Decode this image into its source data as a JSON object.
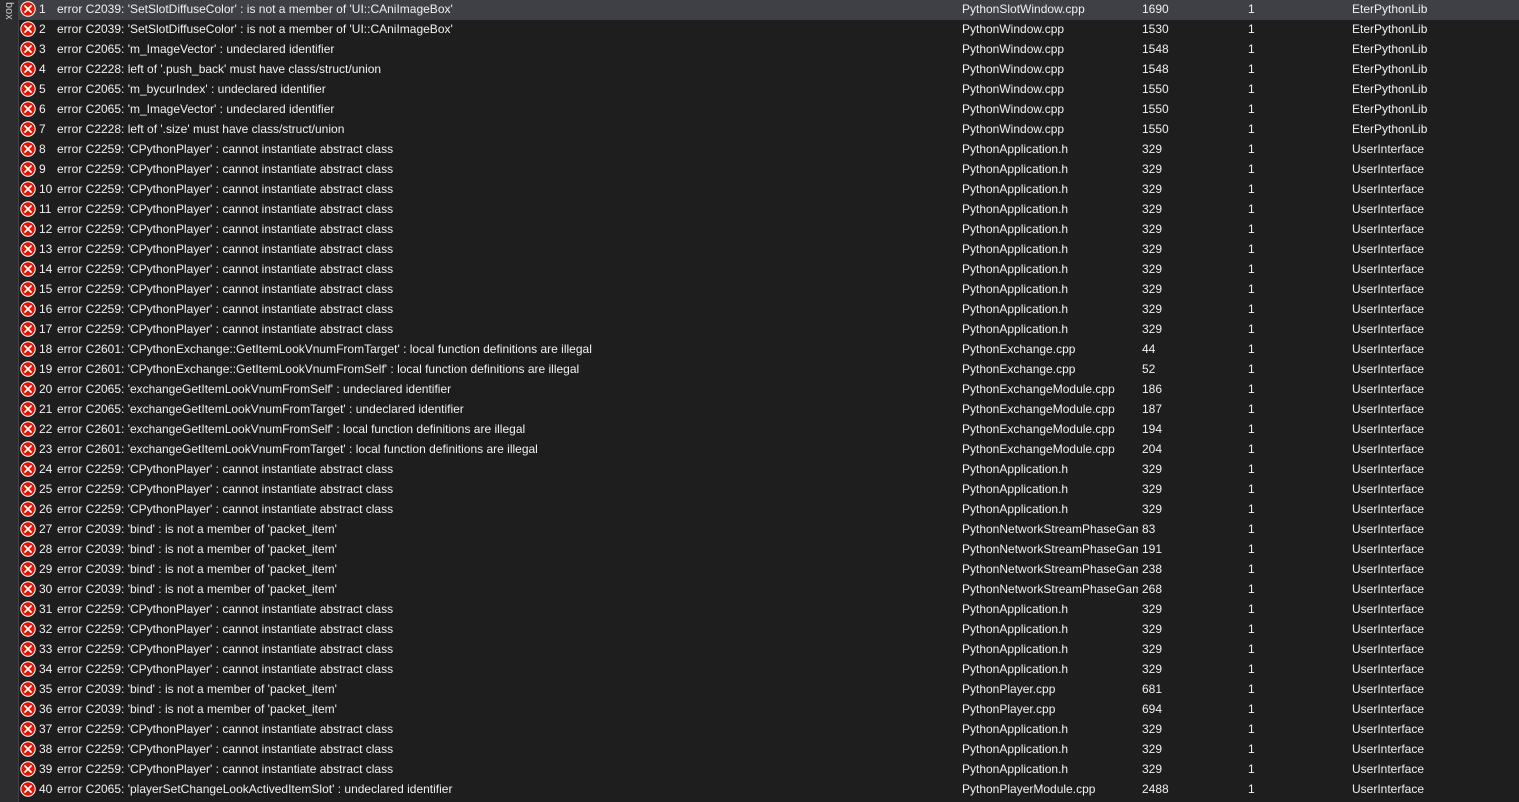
{
  "panel": {
    "side_label": "box"
  },
  "errors": [
    {
      "num": "1",
      "desc": "error C2039: 'SetSlotDiffuseColor' : is not a member of 'UI::CAniImageBox'",
      "file": "PythonSlotWindow.cpp",
      "line": "1690",
      "col": "1",
      "project": "EterPythonLib"
    },
    {
      "num": "2",
      "desc": "error C2039: 'SetSlotDiffuseColor' : is not a member of 'UI::CAniImageBox'",
      "file": "PythonWindow.cpp",
      "line": "1530",
      "col": "1",
      "project": "EterPythonLib"
    },
    {
      "num": "3",
      "desc": "error C2065: 'm_ImageVector' : undeclared identifier",
      "file": "PythonWindow.cpp",
      "line": "1548",
      "col": "1",
      "project": "EterPythonLib"
    },
    {
      "num": "4",
      "desc": "error C2228: left of '.push_back' must have class/struct/union",
      "file": "PythonWindow.cpp",
      "line": "1548",
      "col": "1",
      "project": "EterPythonLib"
    },
    {
      "num": "5",
      "desc": "error C2065: 'm_bycurIndex' : undeclared identifier",
      "file": "PythonWindow.cpp",
      "line": "1550",
      "col": "1",
      "project": "EterPythonLib"
    },
    {
      "num": "6",
      "desc": "error C2065: 'm_ImageVector' : undeclared identifier",
      "file": "PythonWindow.cpp",
      "line": "1550",
      "col": "1",
      "project": "EterPythonLib"
    },
    {
      "num": "7",
      "desc": "error C2228: left of '.size' must have class/struct/union",
      "file": "PythonWindow.cpp",
      "line": "1550",
      "col": "1",
      "project": "EterPythonLib"
    },
    {
      "num": "8",
      "desc": "error C2259: 'CPythonPlayer' : cannot instantiate abstract class",
      "file": "PythonApplication.h",
      "line": "329",
      "col": "1",
      "project": "UserInterface"
    },
    {
      "num": "9",
      "desc": "error C2259: 'CPythonPlayer' : cannot instantiate abstract class",
      "file": "PythonApplication.h",
      "line": "329",
      "col": "1",
      "project": "UserInterface"
    },
    {
      "num": "10",
      "desc": "error C2259: 'CPythonPlayer' : cannot instantiate abstract class",
      "file": "PythonApplication.h",
      "line": "329",
      "col": "1",
      "project": "UserInterface"
    },
    {
      "num": "11",
      "desc": "error C2259: 'CPythonPlayer' : cannot instantiate abstract class",
      "file": "PythonApplication.h",
      "line": "329",
      "col": "1",
      "project": "UserInterface"
    },
    {
      "num": "12",
      "desc": "error C2259: 'CPythonPlayer' : cannot instantiate abstract class",
      "file": "PythonApplication.h",
      "line": "329",
      "col": "1",
      "project": "UserInterface"
    },
    {
      "num": "13",
      "desc": "error C2259: 'CPythonPlayer' : cannot instantiate abstract class",
      "file": "PythonApplication.h",
      "line": "329",
      "col": "1",
      "project": "UserInterface"
    },
    {
      "num": "14",
      "desc": "error C2259: 'CPythonPlayer' : cannot instantiate abstract class",
      "file": "PythonApplication.h",
      "line": "329",
      "col": "1",
      "project": "UserInterface"
    },
    {
      "num": "15",
      "desc": "error C2259: 'CPythonPlayer' : cannot instantiate abstract class",
      "file": "PythonApplication.h",
      "line": "329",
      "col": "1",
      "project": "UserInterface"
    },
    {
      "num": "16",
      "desc": "error C2259: 'CPythonPlayer' : cannot instantiate abstract class",
      "file": "PythonApplication.h",
      "line": "329",
      "col": "1",
      "project": "UserInterface"
    },
    {
      "num": "17",
      "desc": "error C2259: 'CPythonPlayer' : cannot instantiate abstract class",
      "file": "PythonApplication.h",
      "line": "329",
      "col": "1",
      "project": "UserInterface"
    },
    {
      "num": "18",
      "desc": "error C2601: 'CPythonExchange::GetItemLookVnumFromTarget' : local function definitions are illegal",
      "file": "PythonExchange.cpp",
      "line": "44",
      "col": "1",
      "project": "UserInterface"
    },
    {
      "num": "19",
      "desc": "error C2601: 'CPythonExchange::GetItemLookVnumFromSelf' : local function definitions are illegal",
      "file": "PythonExchange.cpp",
      "line": "52",
      "col": "1",
      "project": "UserInterface"
    },
    {
      "num": "20",
      "desc": "error C2065: 'exchangeGetItemLookVnumFromSelf' : undeclared identifier",
      "file": "PythonExchangeModule.cpp",
      "line": "186",
      "col": "1",
      "project": "UserInterface"
    },
    {
      "num": "21",
      "desc": "error C2065: 'exchangeGetItemLookVnumFromTarget' : undeclared identifier",
      "file": "PythonExchangeModule.cpp",
      "line": "187",
      "col": "1",
      "project": "UserInterface"
    },
    {
      "num": "22",
      "desc": "error C2601: 'exchangeGetItemLookVnumFromSelf' : local function definitions are illegal",
      "file": "PythonExchangeModule.cpp",
      "line": "194",
      "col": "1",
      "project": "UserInterface"
    },
    {
      "num": "23",
      "desc": "error C2601: 'exchangeGetItemLookVnumFromTarget' : local function definitions are illegal",
      "file": "PythonExchangeModule.cpp",
      "line": "204",
      "col": "1",
      "project": "UserInterface"
    },
    {
      "num": "24",
      "desc": "error C2259: 'CPythonPlayer' : cannot instantiate abstract class",
      "file": "PythonApplication.h",
      "line": "329",
      "col": "1",
      "project": "UserInterface"
    },
    {
      "num": "25",
      "desc": "error C2259: 'CPythonPlayer' : cannot instantiate abstract class",
      "file": "PythonApplication.h",
      "line": "329",
      "col": "1",
      "project": "UserInterface"
    },
    {
      "num": "26",
      "desc": "error C2259: 'CPythonPlayer' : cannot instantiate abstract class",
      "file": "PythonApplication.h",
      "line": "329",
      "col": "1",
      "project": "UserInterface"
    },
    {
      "num": "27",
      "desc": "error C2039: 'bind' : is not a member of 'packet_item'",
      "file": "PythonNetworkStreamPhaseGam",
      "line": "83",
      "col": "1",
      "project": "UserInterface"
    },
    {
      "num": "28",
      "desc": "error C2039: 'bind' : is not a member of 'packet_item'",
      "file": "PythonNetworkStreamPhaseGam",
      "line": "191",
      "col": "1",
      "project": "UserInterface"
    },
    {
      "num": "29",
      "desc": "error C2039: 'bind' : is not a member of 'packet_item'",
      "file": "PythonNetworkStreamPhaseGam",
      "line": "238",
      "col": "1",
      "project": "UserInterface"
    },
    {
      "num": "30",
      "desc": "error C2039: 'bind' : is not a member of 'packet_item'",
      "file": "PythonNetworkStreamPhaseGam",
      "line": "268",
      "col": "1",
      "project": "UserInterface"
    },
    {
      "num": "31",
      "desc": "error C2259: 'CPythonPlayer' : cannot instantiate abstract class",
      "file": "PythonApplication.h",
      "line": "329",
      "col": "1",
      "project": "UserInterface"
    },
    {
      "num": "32",
      "desc": "error C2259: 'CPythonPlayer' : cannot instantiate abstract class",
      "file": "PythonApplication.h",
      "line": "329",
      "col": "1",
      "project": "UserInterface"
    },
    {
      "num": "33",
      "desc": "error C2259: 'CPythonPlayer' : cannot instantiate abstract class",
      "file": "PythonApplication.h",
      "line": "329",
      "col": "1",
      "project": "UserInterface"
    },
    {
      "num": "34",
      "desc": "error C2259: 'CPythonPlayer' : cannot instantiate abstract class",
      "file": "PythonApplication.h",
      "line": "329",
      "col": "1",
      "project": "UserInterface"
    },
    {
      "num": "35",
      "desc": "error C2039: 'bind' : is not a member of 'packet_item'",
      "file": "PythonPlayer.cpp",
      "line": "681",
      "col": "1",
      "project": "UserInterface"
    },
    {
      "num": "36",
      "desc": "error C2039: 'bind' : is not a member of 'packet_item'",
      "file": "PythonPlayer.cpp",
      "line": "694",
      "col": "1",
      "project": "UserInterface"
    },
    {
      "num": "37",
      "desc": "error C2259: 'CPythonPlayer' : cannot instantiate abstract class",
      "file": "PythonApplication.h",
      "line": "329",
      "col": "1",
      "project": "UserInterface"
    },
    {
      "num": "38",
      "desc": "error C2259: 'CPythonPlayer' : cannot instantiate abstract class",
      "file": "PythonApplication.h",
      "line": "329",
      "col": "1",
      "project": "UserInterface"
    },
    {
      "num": "39",
      "desc": "error C2259: 'CPythonPlayer' : cannot instantiate abstract class",
      "file": "PythonApplication.h",
      "line": "329",
      "col": "1",
      "project": "UserInterface"
    },
    {
      "num": "40",
      "desc": "error C2065: 'playerSetChangeLookActivedItemSlot' : undeclared identifier",
      "file": "PythonPlayerModule.cpp",
      "line": "2488",
      "col": "1",
      "project": "UserInterface"
    }
  ],
  "style": {
    "error_icon": "error-circle-icon",
    "error_color": "#e51400",
    "selected_row_color": "#3f3f46",
    "background": "#1e1e1e"
  }
}
